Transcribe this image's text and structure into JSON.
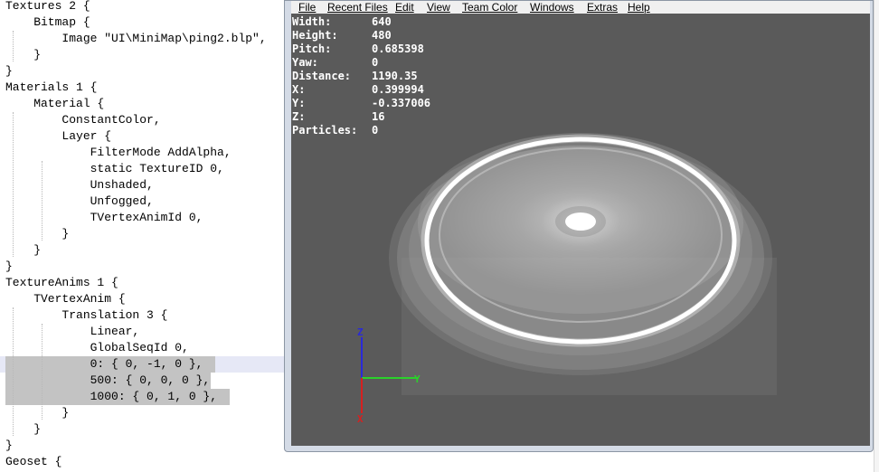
{
  "editor": {
    "lines": [
      "Textures 2 {",
      "    Bitmap {",
      "        Image \"UI\\MiniMap\\ping2.blp\",",
      "    }",
      "}",
      "Materials 1 {",
      "    Material {",
      "        ConstantColor,",
      "        Layer {",
      "            FilterMode AddAlpha,",
      "            static TextureID 0,",
      "            Unshaded,",
      "            Unfogged,",
      "            TVertexAnimId 0,",
      "        }",
      "    }",
      "}",
      "TextureAnims 1 {",
      "    TVertexAnim {",
      "        Translation 3 {",
      "            Linear,",
      "            GlobalSeqId 0,",
      "            0: { 0, -1, 0 },",
      "            500: { 0, 0, 0 },",
      "            1000: { 0, 1, 0 },",
      "        }",
      "    }",
      "}",
      "Geoset {"
    ]
  },
  "viewer": {
    "menu": [
      "File",
      "Recent Files",
      "Edit",
      "View",
      "Team Color",
      "Windows",
      "Extras",
      "Help"
    ],
    "stats": [
      {
        "key": "Width:",
        "value": "640"
      },
      {
        "key": "Height:",
        "value": "480"
      },
      {
        "key": "Pitch:",
        "value": "0.685398"
      },
      {
        "key": "Yaw:",
        "value": "0"
      },
      {
        "key": "Distance:",
        "value": "1190.35"
      },
      {
        "key": "X:",
        "value": "0.399994"
      },
      {
        "key": "Y:",
        "value": "-0.337006"
      },
      {
        "key": "Z:",
        "value": "16"
      },
      {
        "key": "Particles:",
        "value": "0"
      }
    ],
    "axes": {
      "z": "Z",
      "y": "Y",
      "x": "X"
    },
    "colors": {
      "viewport": "#5a5a5a",
      "x_axis": "#d62020",
      "y_axis": "#2bd12b",
      "z_axis": "#2a2ad8"
    }
  }
}
